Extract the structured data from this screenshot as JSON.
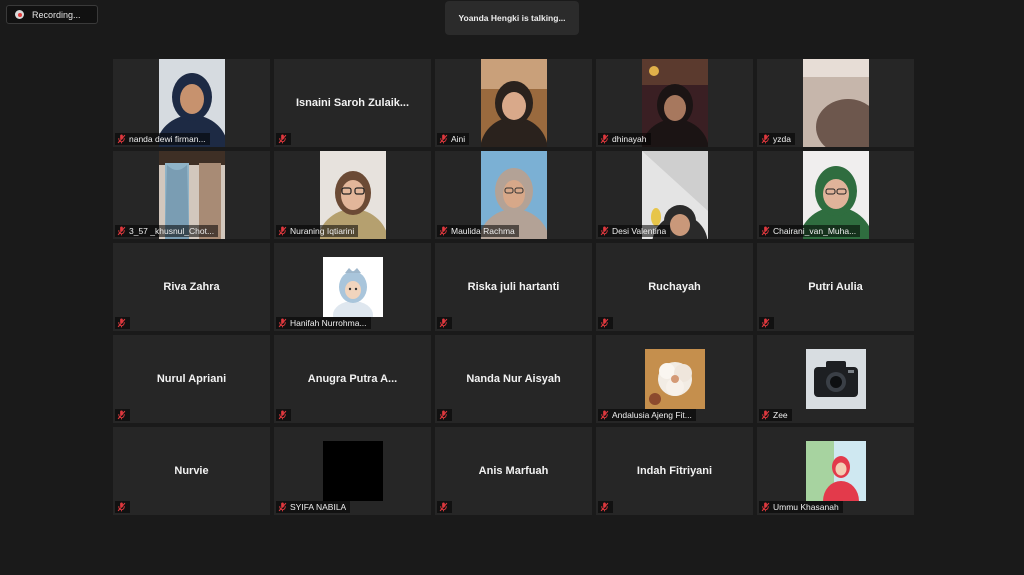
{
  "recording": {
    "label": "Recording..."
  },
  "speaker": {
    "text": "Yoanda Hengki is talking..."
  },
  "colors": {
    "tile_bg": "#262626",
    "muted_icon": "#e0383e",
    "page_bg": "#1a1a1a"
  },
  "participants": [
    {
      "name": "nanda dewi firman...",
      "media": "video",
      "muted": true
    },
    {
      "name": "Isnaini Saroh Zulaik...",
      "media": "none",
      "muted": true
    },
    {
      "name": "Aini",
      "media": "video",
      "muted": true
    },
    {
      "name": "dhinayah",
      "media": "video",
      "muted": true
    },
    {
      "name": "yzda",
      "media": "video",
      "muted": true
    },
    {
      "name": "3_57 _khusnul_Chot...",
      "media": "video",
      "muted": true
    },
    {
      "name": "Nuraning Iqtiarini",
      "media": "video",
      "muted": true
    },
    {
      "name": "Maulida Rachma",
      "media": "video",
      "muted": true
    },
    {
      "name": "Desi Valentina",
      "media": "video",
      "muted": true
    },
    {
      "name": "Chairani_van_Muha...",
      "media": "video",
      "muted": true
    },
    {
      "name": "Riva Zahra",
      "media": "none",
      "muted": true
    },
    {
      "name": "Hanifah Nurrohma...",
      "media": "profile-picture",
      "muted": true
    },
    {
      "name": "Riska juli hartanti",
      "media": "none",
      "muted": true
    },
    {
      "name": "Ruchayah",
      "media": "none",
      "muted": true
    },
    {
      "name": "Putri Aulia",
      "media": "none",
      "muted": true
    },
    {
      "name": "Nurul Apriani",
      "media": "none",
      "muted": true
    },
    {
      "name": "Anugra Putra A...",
      "media": "none",
      "muted": true
    },
    {
      "name": "Nanda Nur Aisyah",
      "media": "none",
      "muted": true
    },
    {
      "name": "Andalusia Ajeng Fit...",
      "media": "profile-picture",
      "muted": true
    },
    {
      "name": "Zee",
      "media": "profile-picture",
      "muted": true
    },
    {
      "name": "Nurvie",
      "media": "none",
      "muted": true
    },
    {
      "name": "SYIFA NABILA",
      "media": "profile-picture",
      "muted": true
    },
    {
      "name": "Anis Marfuah",
      "media": "none",
      "muted": true
    },
    {
      "name": "Indah Fitriyani",
      "media": "none",
      "muted": true
    },
    {
      "name": "Ummu Khasanah",
      "media": "profile-picture",
      "muted": true
    }
  ]
}
